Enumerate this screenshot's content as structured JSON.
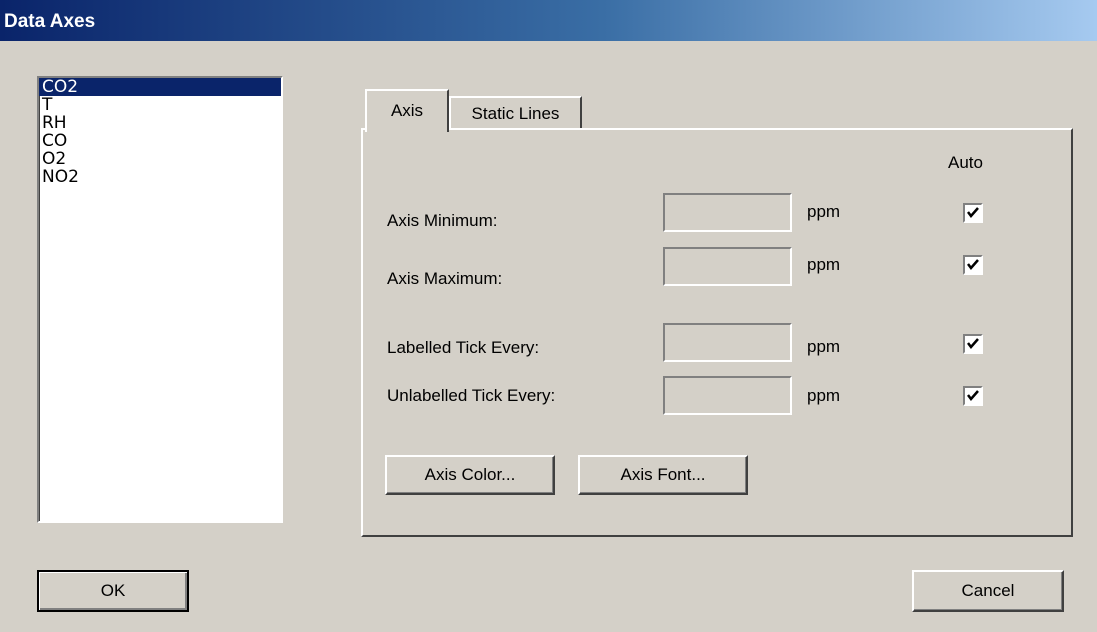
{
  "window": {
    "title": "Data Axes"
  },
  "data_list": {
    "items": [
      "CO2",
      "T",
      "RH",
      "CO",
      "O2",
      "NO2"
    ],
    "selected": "CO2"
  },
  "tabs": [
    {
      "label": "Axis",
      "active": true
    },
    {
      "label": "Static Lines",
      "active": false
    }
  ],
  "axis_panel": {
    "auto_header": "Auto",
    "rows": [
      {
        "label": "Axis Minimum:",
        "value": "",
        "unit": "ppm",
        "auto_checked": true
      },
      {
        "label": "Axis Maximum:",
        "value": "",
        "unit": "ppm",
        "auto_checked": true
      },
      {
        "label": "Labelled Tick Every:",
        "value": "",
        "unit": "ppm",
        "auto_checked": true
      },
      {
        "label": "Unlabelled Tick Every:",
        "value": "",
        "unit": "ppm",
        "auto_checked": true
      }
    ],
    "axis_color_button": "Axis Color...",
    "axis_font_button": "Axis Font..."
  },
  "buttons": {
    "ok": "OK",
    "cancel": "Cancel"
  },
  "colors": {
    "titlebar_start": "#0a246a",
    "titlebar_end": "#a6caf0",
    "face": "#d4d0c8",
    "selection": "#0a246a"
  }
}
